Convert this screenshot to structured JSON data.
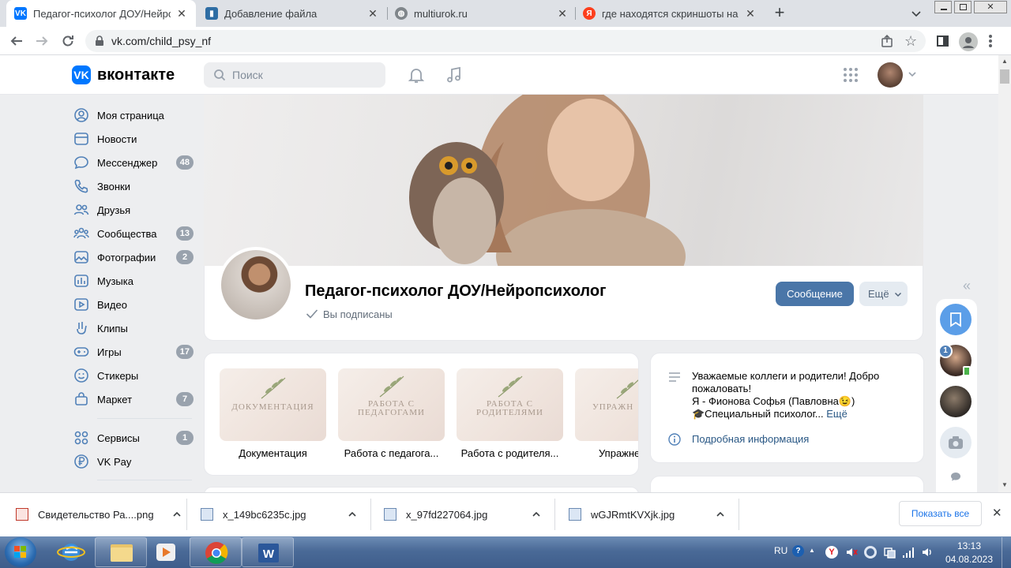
{
  "browser": {
    "tabs": [
      {
        "title": "Педагог-психолог ДОУ/Нейропс",
        "favicon": "vk-favicon",
        "active": true
      },
      {
        "title": "Добавление файла",
        "favicon": "book-favicon",
        "active": false
      },
      {
        "title": "multiurok.ru",
        "favicon": "globe-favicon",
        "active": false
      },
      {
        "title": "где находятся скриншоты на ко",
        "favicon": "yandex-favicon",
        "active": false
      }
    ],
    "new_tab": "+",
    "url": "vk.com/child_psy_nf"
  },
  "vk": {
    "logo_text": "вконтакте",
    "search_placeholder": "Поиск",
    "sidebar": [
      {
        "label": "Моя страница",
        "icon": "user-circle-icon",
        "badge": ""
      },
      {
        "label": "Новости",
        "icon": "news-icon",
        "badge": ""
      },
      {
        "label": "Мессенджер",
        "icon": "message-icon",
        "badge": "48"
      },
      {
        "label": "Звонки",
        "icon": "phone-icon",
        "badge": ""
      },
      {
        "label": "Друзья",
        "icon": "friends-icon",
        "badge": ""
      },
      {
        "label": "Сообщества",
        "icon": "communities-icon",
        "badge": "13"
      },
      {
        "label": "Фотографии",
        "icon": "photo-icon",
        "badge": "2"
      },
      {
        "label": "Музыка",
        "icon": "music-icon",
        "badge": ""
      },
      {
        "label": "Видео",
        "icon": "video-icon",
        "badge": ""
      },
      {
        "label": "Клипы",
        "icon": "clips-icon",
        "badge": ""
      },
      {
        "label": "Игры",
        "icon": "games-icon",
        "badge": "17"
      },
      {
        "label": "Стикеры",
        "icon": "smile-icon",
        "badge": ""
      },
      {
        "label": "Маркет",
        "icon": "bag-icon",
        "badge": "7"
      },
      {
        "label": "Сервисы",
        "icon": "services-icon",
        "badge": "1"
      },
      {
        "label": "VK Pay",
        "icon": "ruble-icon",
        "badge": ""
      }
    ],
    "profile": {
      "name": "Педагог-психолог ДОУ/Нейропсихолог",
      "subscribed": "Вы подписаны",
      "message_button": "Сообщение",
      "more_button": "Ещё"
    },
    "albums": [
      {
        "cover_text": "ДОКУМЕНТАЦИЯ",
        "caption": "Документация"
      },
      {
        "cover_text": "РАБОТА С ПЕДАГОГАМИ",
        "caption": "Работа с педагога..."
      },
      {
        "cover_text": "РАБОТА С РОДИТЕЛЯМИ",
        "caption": "Работа с родителя..."
      },
      {
        "cover_text": "УПРАЖН",
        "caption": "Упражне"
      }
    ],
    "about": {
      "line1": "Уважаемые коллеги и родители! Добро",
      "line2": "пожаловать!",
      "line3": "Я - Фионова Софья (Павловна😉)",
      "line4": "🎓Специальный психолог...",
      "more": "Ещё",
      "details": "Подробная информация"
    },
    "right_rail": {
      "unread_badge": "1",
      "collapse": "«"
    }
  },
  "downloads": {
    "items": [
      "Свидетельство Ра....png",
      "x_149bc6235c.jpg",
      "x_97fd227064.jpg",
      "wGJRmtKVXjk.jpg"
    ],
    "show_all": "Показать все"
  },
  "taskbar": {
    "lang": "RU",
    "time": "13:13",
    "date": "04.08.2023"
  },
  "colors": {
    "vk_blue": "#0077ff",
    "button_blue": "#4a76a8",
    "page_bg": "#edeef0"
  }
}
